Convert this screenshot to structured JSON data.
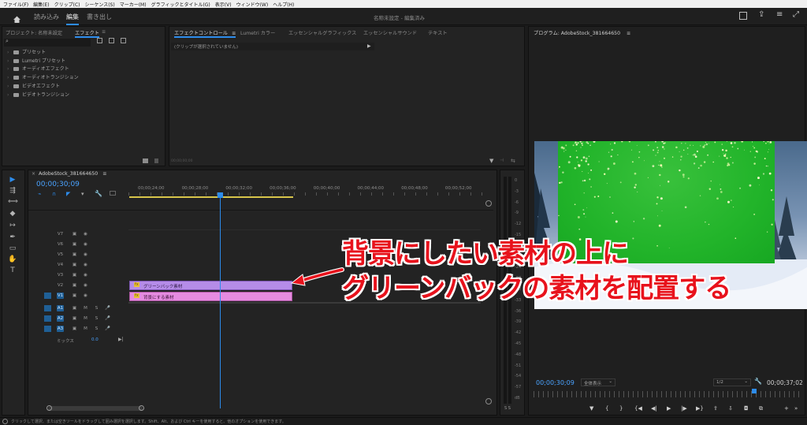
{
  "menu": [
    "ファイル(F)",
    "編集(E)",
    "クリップ(C)",
    "シーケンス(S)",
    "マーカー(M)",
    "グラフィックとタイトル(G)",
    "表示(V)",
    "ウィンドウ(W)",
    "ヘルプ(H)"
  ],
  "workspaces": {
    "import": "読み込み",
    "edit": "編集",
    "export": "書き出し"
  },
  "project_title": "名称未設定 - 編集済み",
  "left_panel": {
    "tab_project": "プロジェクト: 名称未設定",
    "tab_effects": "エフェクト",
    "tree": [
      "プリセット",
      "Lumetri プリセット",
      "オーディオエフェクト",
      "オーディオトランジション",
      "ビデオエフェクト",
      "ビデオトランジション"
    ]
  },
  "effect_controls": {
    "tabs": [
      "エフェクトコントロール",
      "Lumetri カラー",
      "エッセンシャルグラフィックス",
      "エッセンシャルサウンド",
      "テキスト"
    ],
    "no_clip": "(クリップが選択されていません)",
    "footer_time": "00;00;00;00"
  },
  "program_monitor": {
    "title": "プログラム: AdobeStock_381664650",
    "current_time": "00;00;30;09",
    "fit": "全体表示",
    "resolution": "1/2",
    "duration": "00;00;37;02"
  },
  "timeline": {
    "sequence_name": "AdobeStock_381664650",
    "timecode": "00;00;30;09",
    "ruler": [
      "00;00;24;00",
      "00;00;28;00",
      "00;00;32;00",
      "00;00;36;00",
      "00;00;40;00",
      "00;00;44;00",
      "00;00;48;00",
      "00;00;52;00"
    ],
    "video_tracks": [
      "V7",
      "V6",
      "V5",
      "V4",
      "V3",
      "V2",
      "V1"
    ],
    "audio_tracks": [
      "A1",
      "A2",
      "A3"
    ],
    "mix_label": "ミックス",
    "mix_value": "0.0",
    "clip_v2": "グリーンバック素材",
    "clip_v1": "背景にする素材",
    "fx_badge": "fx"
  },
  "meter": {
    "scale": [
      "0",
      "-3",
      "-6",
      "-9",
      "-12",
      "-15",
      "-18",
      "-21",
      "-24",
      "-27",
      "-30",
      "-33",
      "-36",
      "-39",
      "-42",
      "-45",
      "-48",
      "-51",
      "-54",
      "-57",
      "dB"
    ],
    "solo": "S S"
  },
  "track_buttons": {
    "m": "M",
    "s": "S"
  },
  "annotation": {
    "line1": "背景にしたい素材の上に",
    "line2": "グリーンバックの素材を配置する",
    "color": "#e8121c"
  },
  "status_bar": "クリックして選択、または空きツールをドラッグして囲み選択を選択します。Shift、Alt、および Ctrl キーを使用すると、他のオプションを使用できます。",
  "colors": {
    "accent": "#2d8ceb",
    "clip_v2": "#b58ce8",
    "clip_v1": "#e58be0",
    "green_screen": "#23b52a"
  }
}
